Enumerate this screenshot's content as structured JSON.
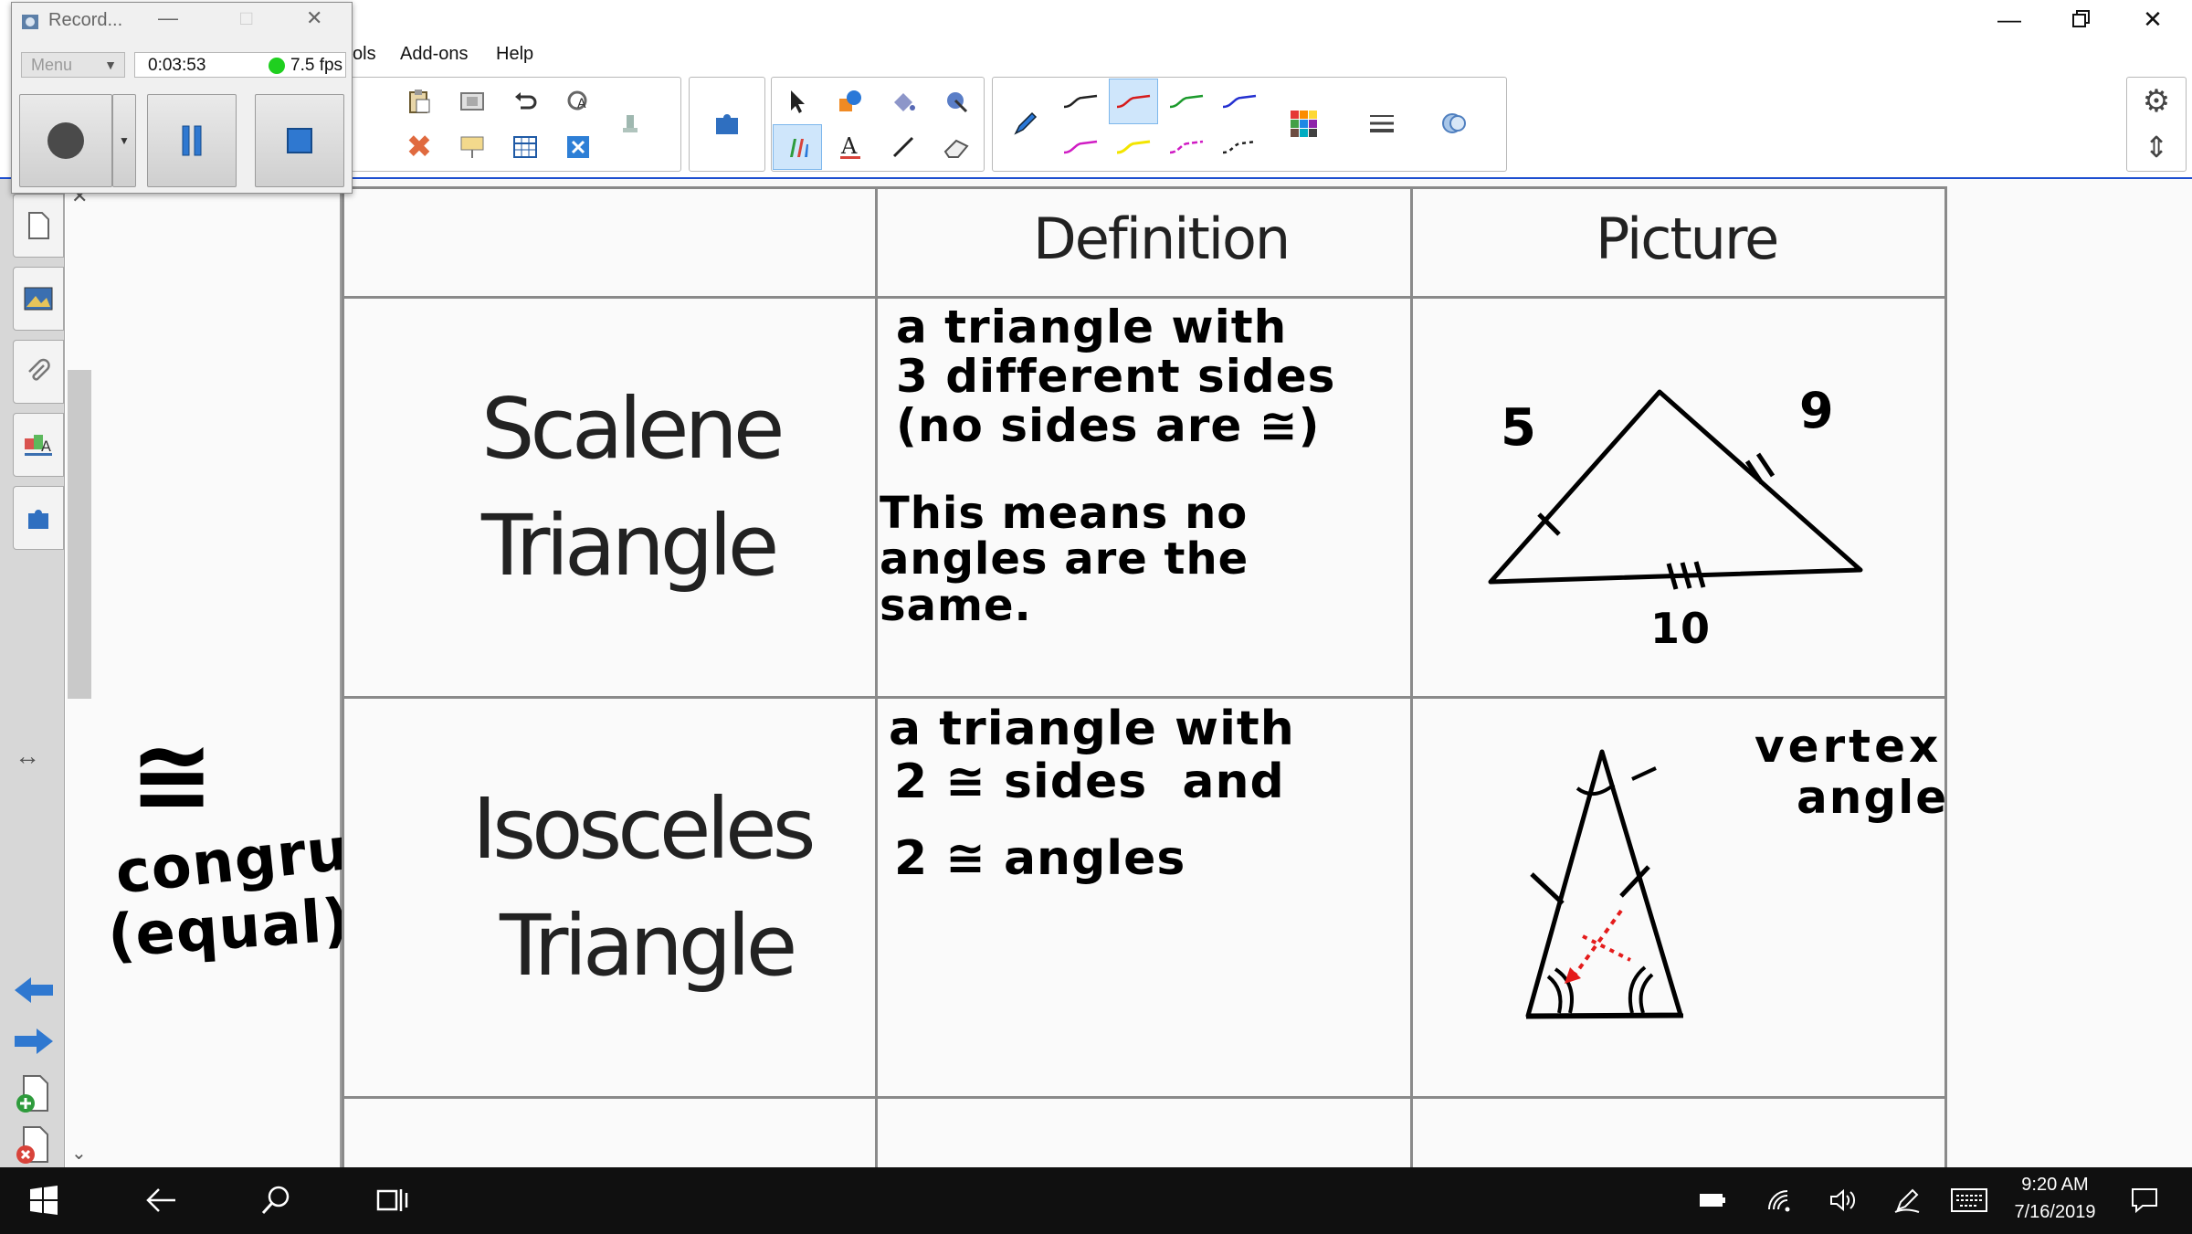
{
  "menubar": {
    "items": [
      "ols",
      "Add-ons",
      "Help"
    ]
  },
  "recorder": {
    "title": "Record...",
    "menu_label": "Menu",
    "elapsed": "0:03:53",
    "fps": "7.5 fps"
  },
  "table": {
    "headers": {
      "definition": "Definition",
      "picture": "Picture"
    },
    "rows": [
      {
        "term_line1": "Scalene",
        "term_line2": "Triangle",
        "definition": "a triangle with\n3 different sides\n(no sides are ≅)",
        "note": "This means no\nangles are the\nsame.",
        "side_labels": [
          "5",
          "9",
          "10"
        ]
      },
      {
        "term_line1": "Isosceles",
        "term_line2": "Triangle",
        "definition_line1": "a triangle with",
        "definition_line2": "2 ≅ sides  and",
        "definition_line3": "2 ≅ angles",
        "vertex_label_line1": "vertex",
        "vertex_label_line2": "angle"
      }
    ]
  },
  "side_note": {
    "symbol": "≅",
    "line1": "congruent",
    "line2": "(equal)"
  },
  "taskbar": {
    "time": "9:20 AM",
    "date": "7/16/2019"
  },
  "colors": {
    "toolbar_accent": "#1e4fd0",
    "taskbar": "#101010",
    "annotation_red": "#e41b1b",
    "fps_indicator": "#1fcf1f"
  },
  "icons": {
    "window": [
      "minimize-icon",
      "restore-icon",
      "close-icon"
    ],
    "tools": [
      "select-icon",
      "shapes-icon",
      "fill-icon",
      "magic-pen-icon",
      "creative-pen-icon",
      "text-icon",
      "line-icon",
      "eraser-icon",
      "pen-icon",
      "color-palette-icon",
      "line-props-icon",
      "fill-props-icon"
    ],
    "side": [
      "page-sorter-icon",
      "gallery-icon",
      "attachments-icon",
      "properties-icon",
      "addons-icon"
    ],
    "taskbar": [
      "windows-icon",
      "back-icon",
      "search-icon",
      "task-view-icon",
      "battery-icon",
      "wifi-icon",
      "volume-icon",
      "pen-tray-icon",
      "keyboard-icon",
      "notifications-icon"
    ]
  }
}
